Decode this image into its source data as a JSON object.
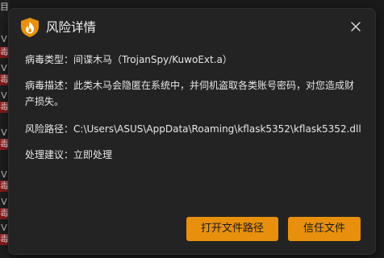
{
  "background": {
    "chars": [
      "目",
      "V",
      "毒",
      "i",
      "V",
      "毒",
      "V",
      "毒",
      "V",
      "毒",
      "V",
      "毒",
      "V",
      "毒",
      "V",
      "毒"
    ]
  },
  "dialog": {
    "title": "风险详情",
    "close_icon": "close-icon",
    "title_icon": "shield-flame-icon",
    "accent": "#e8900d",
    "fields": {
      "virus_type": {
        "label": "病毒类型",
        "sep": "：",
        "value": "间谍木马（TrojanSpy/KuwoExt.a）"
      },
      "description": {
        "label": "病毒描述",
        "sep": "：",
        "value": "此类木马会隐匿在系统中，并伺机盗取各类账号密码，对您造成财产损失。"
      },
      "path": {
        "label": "风险路径",
        "sep": "：",
        "value": "C:\\Users\\ASUS\\AppData\\Roaming\\kflask5352\\kflask5352.dll"
      },
      "suggestion": {
        "label": "处理建议",
        "sep": "：",
        "value": "立即处理"
      }
    },
    "buttons": {
      "open_path": "打开文件路径",
      "trust": "信任文件"
    }
  }
}
